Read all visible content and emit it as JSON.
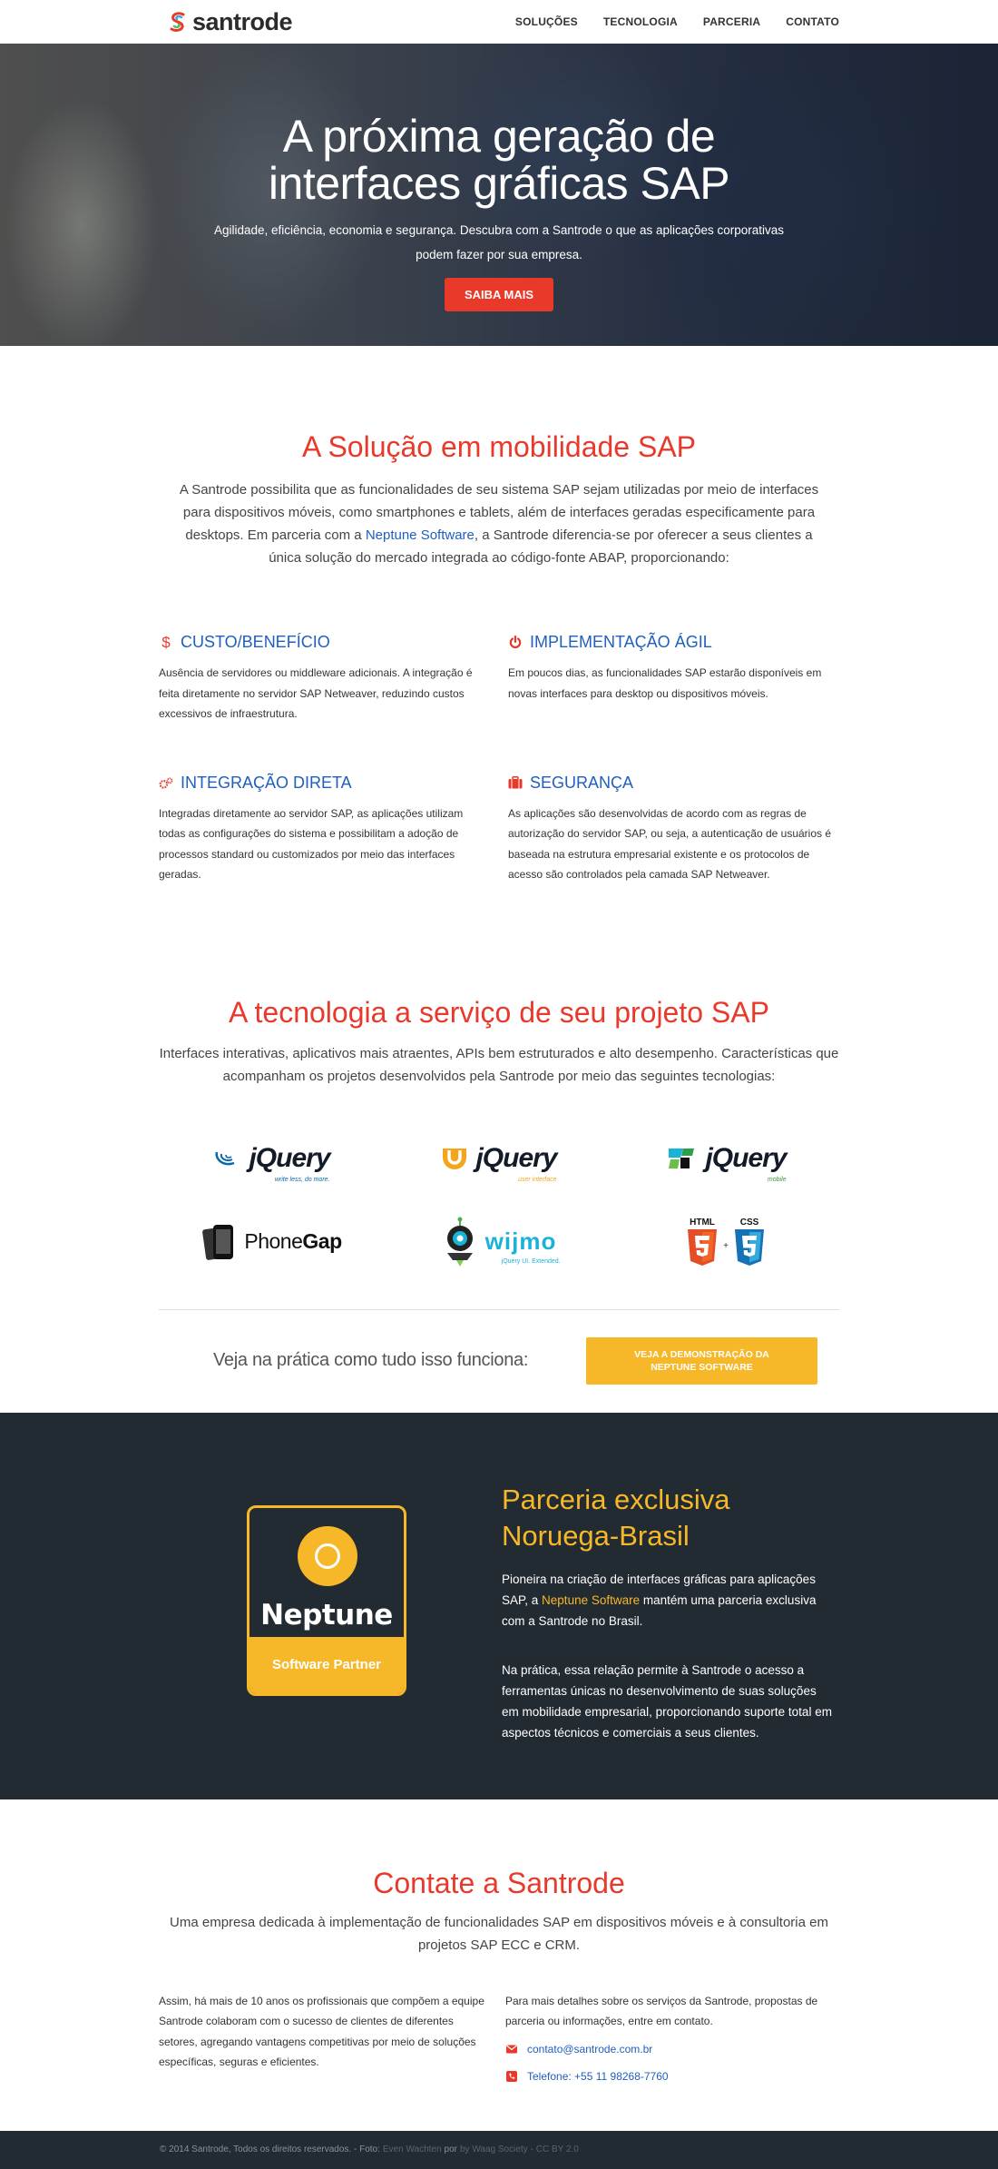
{
  "brand": {
    "name": "santrode"
  },
  "nav": {
    "items": [
      "SOLUÇÕES",
      "TECNOLOGIA",
      "PARCERIA",
      "CONTATO"
    ]
  },
  "hero": {
    "title_line1": "A próxima geração de",
    "title_line2": "interfaces gráficas SAP",
    "subtitle_line1": "Agilidade, eficiência, economia e segurança. Descubra com a Santrode o que as aplicações corporativas",
    "subtitle_line2": "podem fazer por sua empresa.",
    "cta": "SAIBA MAIS"
  },
  "solution": {
    "title": "A Solução em mobilidade SAP",
    "intro_before": "A Santrode possibilita que as funcionalidades de seu sistema SAP sejam utilizadas por meio de interfaces para dispositivos móveis, como smartphones e tablets, além de interfaces geradas especificamente para desktops. Em parceria com a ",
    "intro_link": "Neptune Software",
    "intro_after": ", a Santrode diferencia-se por oferecer a seus clientes a única solução do mercado integrada ao código-fonte ABAP, proporcionando:",
    "features": [
      {
        "icon": "dollar-icon",
        "title": "CUSTO/BENEFÍCIO",
        "text": "Ausência de servidores ou middleware adicionais. A integração é feita diretamente no servidor SAP Netweaver, reduzindo custos excessivos de infraestrutura."
      },
      {
        "icon": "power-icon",
        "title": "IMPLEMENTAÇÃO ÁGIL",
        "text": "Em poucos dias, as funcionalidades SAP estarão disponíveis em novas interfaces para desktop ou dispositivos móveis."
      },
      {
        "icon": "gears-icon",
        "title": "INTEGRAÇÃO DIRETA",
        "text": "Integradas diretamente ao servidor SAP, as aplicações utilizam todas as configurações do sistema e possibilitam a adoção de processos standard ou customizados por meio das interfaces geradas."
      },
      {
        "icon": "briefcase-icon",
        "title": "SEGURANÇA",
        "text": "As aplicações são desenvolvidas de acordo com as regras de autorização do servidor SAP, ou seja, a autenticação de usuários é baseada na estrutura empresarial existente e os protocolos de acesso são controlados pela camada SAP Netweaver."
      }
    ]
  },
  "tech": {
    "title": "A tecnologia a serviço de seu projeto SAP",
    "intro": "Interfaces interativas, aplicativos mais atraentes, APIs bem estruturados e alto desempenho. Características que acompanham os projetos desenvolvidos pela Santrode por meio das seguintes tecnologias:",
    "logos": {
      "jquery": "jQuery",
      "jquery_tag": "write less, do more.",
      "jqueryui": "jQuery",
      "jqueryui_tag": "user interface",
      "jquerymobile": "jQuery",
      "jquerymobile_tag": "mobile",
      "phonegap_a": "Phone",
      "phonegap_b": "Gap",
      "wijmo": "wijmo",
      "wijmo_tag": "jQuery UI. Extended.",
      "html5": "HTML",
      "css3": "CSS"
    },
    "demo_text": "Veja na prática como tudo isso funciona:",
    "demo_button": "VEJA A DEMONSTRAÇÃO DA NEPTUNE SOFTWARE"
  },
  "partner": {
    "badge_name": "Neptune",
    "badge_footer": "Software Partner",
    "title_line1": "Parceria exclusiva",
    "title_line2": "Noruega-Brasil",
    "p1_before": "Pioneira na criação de interfaces gráficas para aplicações SAP, a ",
    "p1_link": "Neptune Software",
    "p1_after": " mantém uma parceria exclusiva com a Santrode no Brasil.",
    "p2": "Na prática, essa relação permite à Santrode o acesso a ferramentas únicas no desenvolvimento de suas soluções em mobilidade empresarial, proporcionando suporte total em aspectos técnicos e comerciais a seus clientes."
  },
  "contact": {
    "title": "Contate a Santrode",
    "intro": "Uma empresa dedicada à implementação de funcionalidades SAP em dispositivos móveis e à consultoria em projetos SAP ECC e CRM.",
    "left": "Assim, há mais de 10 anos os profissionais que compõem a equipe Santrode colaboram com o sucesso de clientes de diferentes setores, agregando vantagens competitivas por meio de soluções específicas, seguras e eficientes.",
    "right": "Para mais detalhes sobre os serviços da Santrode, propostas de parceria ou informações, entre em contato.",
    "email": "contato@santrode.com.br",
    "phone": "Telefone: +55 11 98268-7760"
  },
  "footer": {
    "text": "© 2014 Santrode, Todos os direitos reservados. - Foto:",
    "photo_author": "Even Wachten",
    "by": "por",
    "photo_source": "by Waag Society",
    "license": "- CC BY 2.0"
  },
  "colors": {
    "accent_red": "#e8392b",
    "accent_blue": "#1f5fbf",
    "accent_yellow": "#f6b829",
    "dark": "#222a32"
  }
}
